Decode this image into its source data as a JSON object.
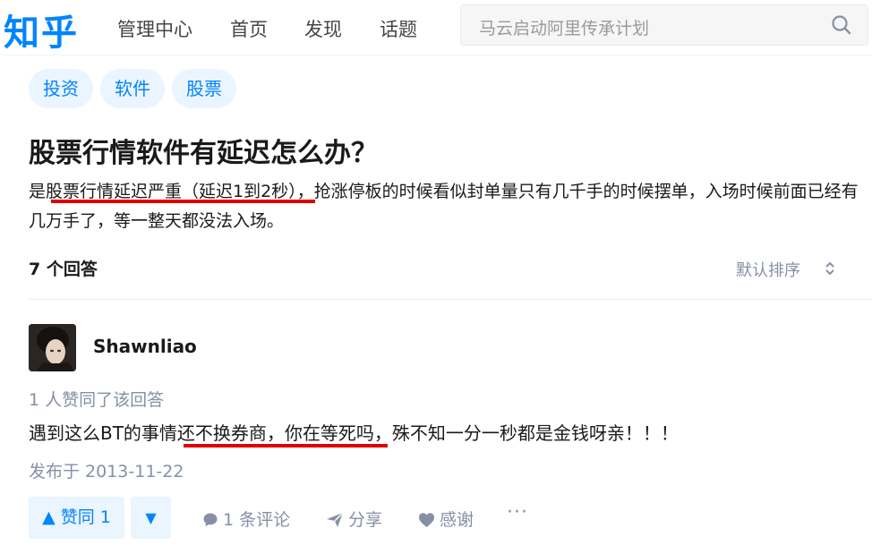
{
  "header": {
    "logo": "知乎",
    "nav": [
      "管理中心",
      "首页",
      "发现",
      "话题"
    ],
    "search_placeholder": "马云启动阿里传承计划"
  },
  "tags": [
    "投资",
    "软件",
    "股票"
  ],
  "question": {
    "title": "股票行情软件有延迟怎么办？",
    "description": "是股票行情延迟严重（延迟1到2秒），抢涨停板的时候看似封单量只有几千手的时候摆单，入场时候前面已经有几万手了，等一整天都没法入场。"
  },
  "answers_header": {
    "count_label": "7 个回答",
    "sort_label": "默认排序"
  },
  "answer": {
    "author": "Shawnliao",
    "voters": "1 人赞同了该回答",
    "content": "遇到这么BT的事情还不换券商，你在等死吗，殊不知一分一秒都是金钱呀亲！！！",
    "date": "发布于 2013-11-22",
    "actions": {
      "upvote": "▲ 赞同 1",
      "downvote": "▼",
      "comment": "1 条评论",
      "share": "分享",
      "thanks": "感谢",
      "more": "···"
    }
  },
  "annotation_color": "#e00000",
  "brand_color": "#0084ff"
}
